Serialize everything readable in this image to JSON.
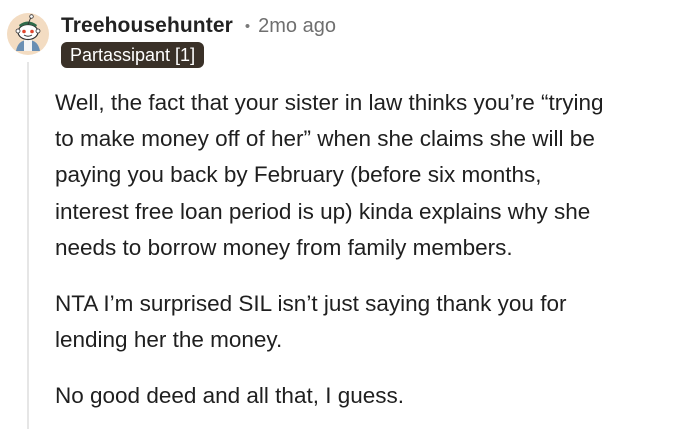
{
  "comment": {
    "username": "Treehousehunter",
    "separator": "•",
    "timestamp": "2mo ago",
    "flair": "Partassipant [1]",
    "avatar_icon": "snoo-avatar-icon",
    "paragraphs": [
      {
        "lines": [
          "Well, the fact that your sister in law thinks you’re “trying",
          "to make money off of her” when she claims she will be",
          "paying you back by February (before six months,",
          "interest free loan period is up) kinda explains why she",
          "needs to borrow money from family members."
        ]
      },
      {
        "lines": [
          "NTA I’m surprised SIL isn’t just saying thank you for",
          "lending her the money."
        ]
      },
      {
        "lines": [
          "No good deed and all that, I guess."
        ]
      }
    ]
  },
  "colors": {
    "flair_bg": "#3a3128",
    "thread_line": "#e6e6e6"
  }
}
